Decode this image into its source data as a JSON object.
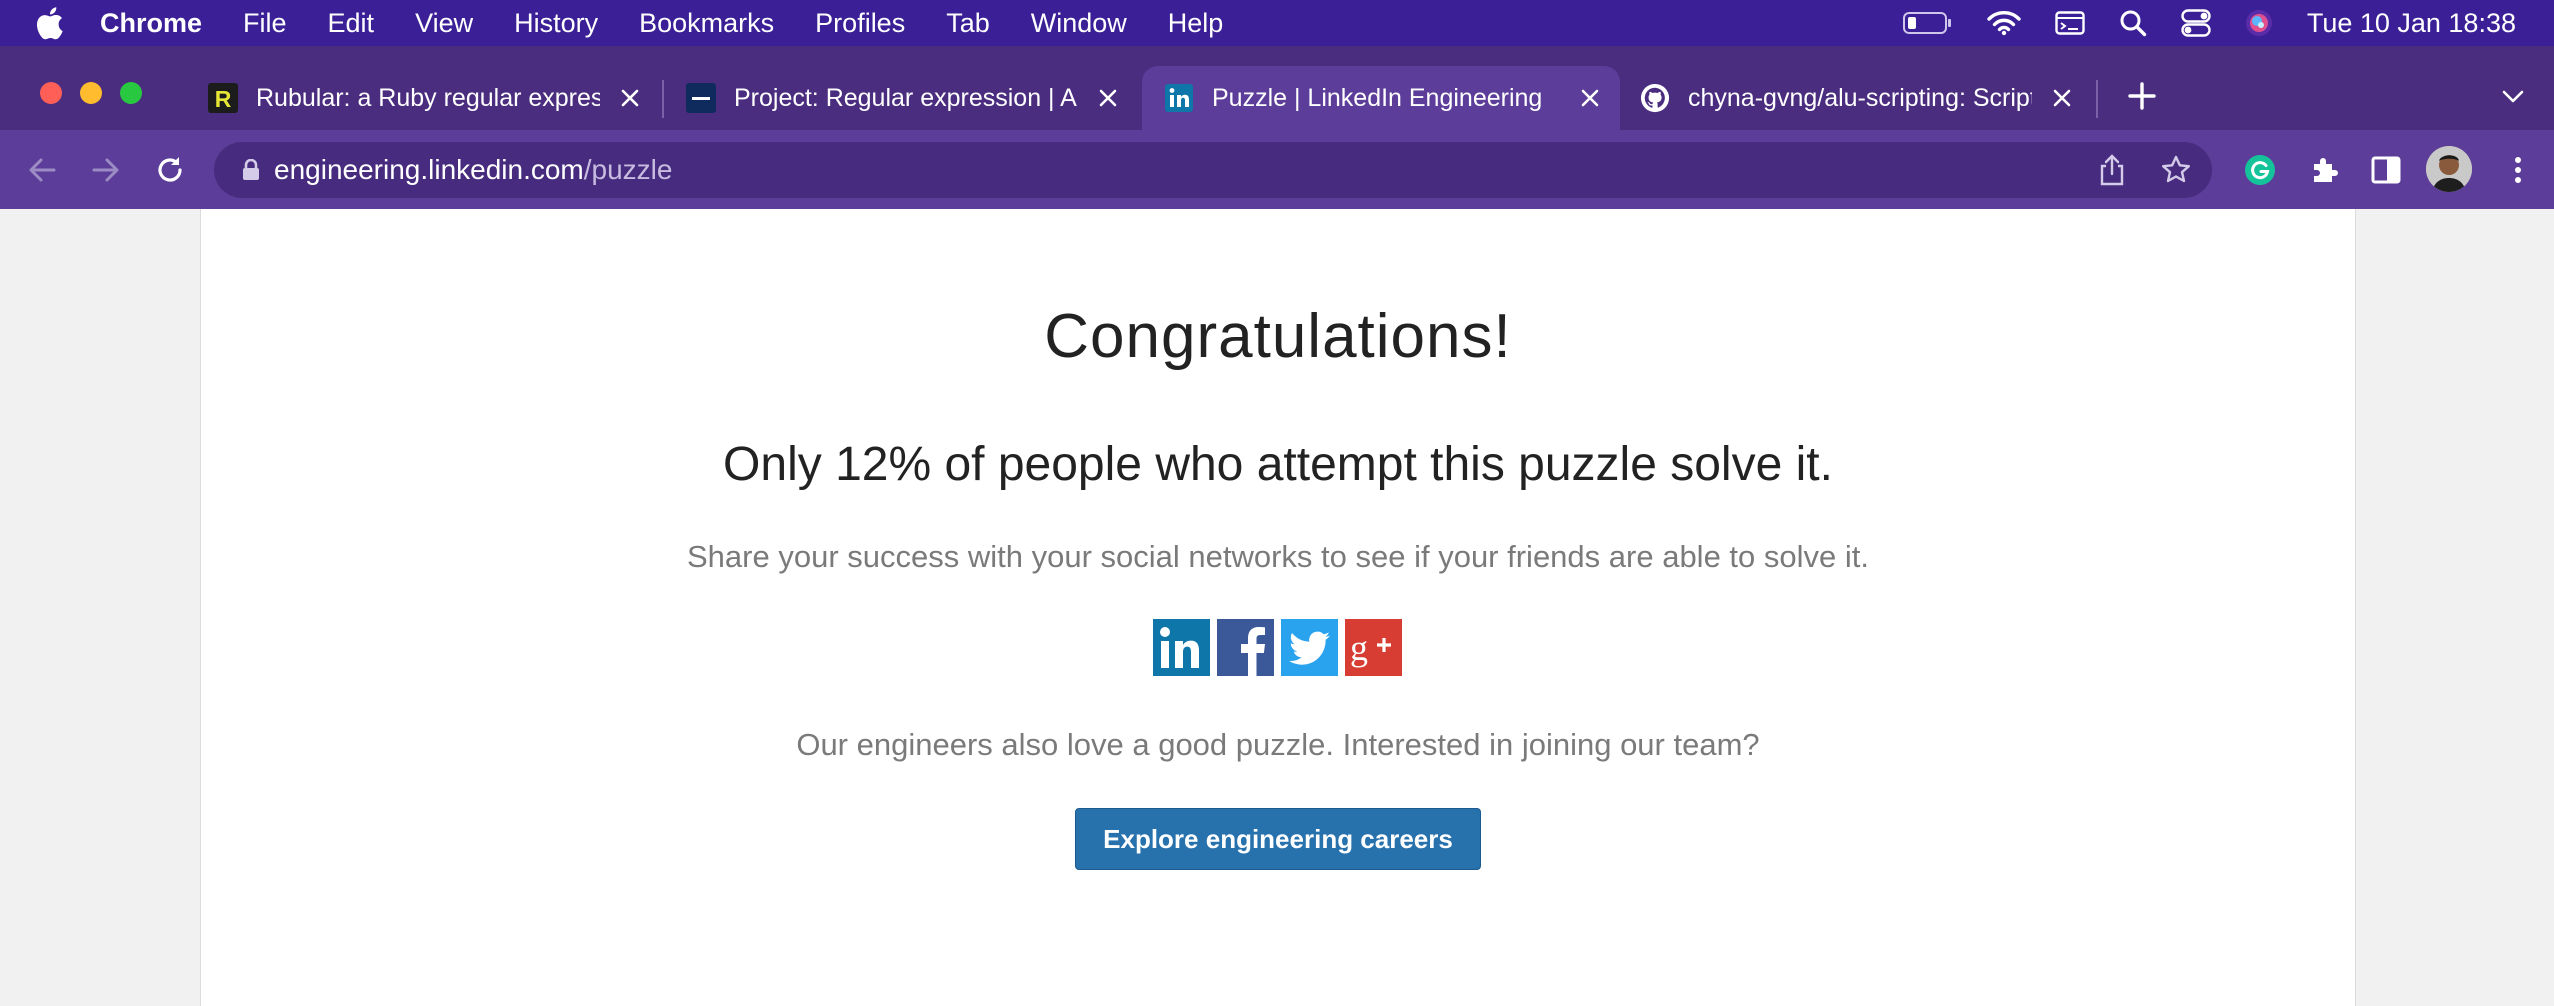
{
  "menubar": {
    "app": "Chrome",
    "items": [
      "File",
      "Edit",
      "View",
      "History",
      "Bookmarks",
      "Profiles",
      "Tab",
      "Window",
      "Help"
    ],
    "clock": "Tue 10 Jan  18:38"
  },
  "tabs": [
    {
      "title": "Rubular: a Ruby regular expression editor",
      "favicon": "R",
      "active": false
    },
    {
      "title": "Project: Regular expression | ALU",
      "favicon": "alu",
      "active": false
    },
    {
      "title": "Puzzle | LinkedIn Engineering",
      "favicon": "in",
      "active": true
    },
    {
      "title": "chyna-gvng/alu-scripting: Scripts",
      "favicon": "github",
      "active": false
    }
  ],
  "address": {
    "host": "engineering.linkedin.com",
    "path": "/puzzle"
  },
  "page": {
    "heading": "Congratulations!",
    "subheading": "Only 12% of people who attempt this puzzle solve it.",
    "share_text": "Share your success with your social networks to see if your friends are able to solve it.",
    "social": [
      "linkedin",
      "facebook",
      "twitter",
      "google-plus"
    ],
    "team_text": "Our engineers also love a good puzzle. Interested in joining our team?",
    "cta": "Explore engineering careers"
  },
  "colors": {
    "menubar": "#3a1f96",
    "tabstrip": "#4b2d7f",
    "toolbar": "#5c3d99",
    "cta": "#2771ad",
    "linkedin": "#0e76a8",
    "facebook": "#3b5998",
    "twitter": "#2aa3ef",
    "google": "#d73d32"
  }
}
